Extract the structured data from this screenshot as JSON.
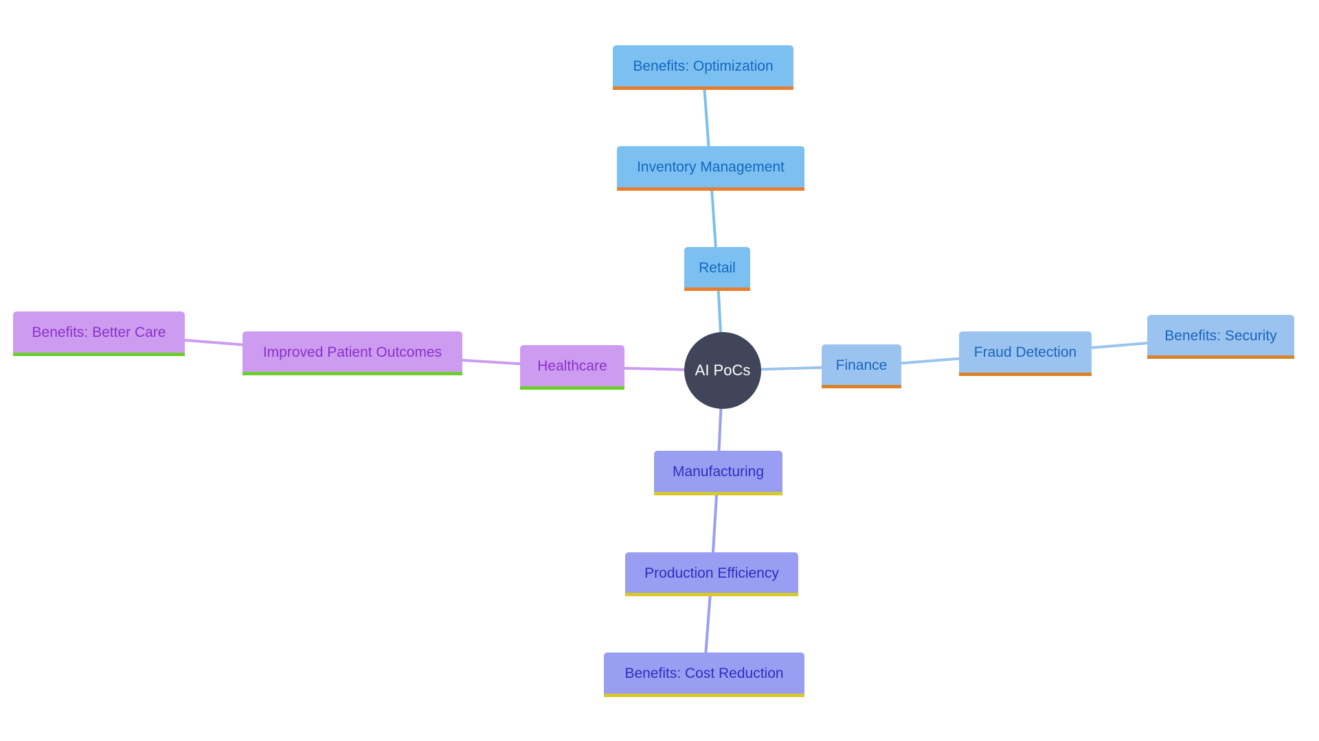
{
  "diagram": {
    "type": "mindmap",
    "root": {
      "id": "root",
      "label": "AI PoCs"
    },
    "colors": {
      "root_fill": "#414559",
      "root_text": "#ffffff",
      "retail": {
        "fill": "#7cc0f1",
        "text": "#1467c0",
        "accent": "#e87d2f",
        "edge": "#7dc0ee"
      },
      "finance": {
        "fill": "#9ac4ef",
        "text": "#1b64bf",
        "accent": "#d8822a",
        "edge": "#9ac4ee"
      },
      "healthcare": {
        "fill": "#cd9cf1",
        "text": "#8b30c9",
        "accent": "#6cce2e",
        "edge": "#cc9cf0"
      },
      "manufacturing": {
        "fill": "#9a9ef2",
        "text": "#2b2fc0",
        "accent": "#d7c92a",
        "edge": "#9a9ef0"
      }
    },
    "nodes": [
      {
        "id": "retail",
        "label": "Retail",
        "branch": "retail",
        "parent": "root"
      },
      {
        "id": "inventory",
        "label": "Inventory Management",
        "branch": "retail",
        "parent": "retail"
      },
      {
        "id": "optimization",
        "label": "Benefits: Optimization",
        "branch": "retail",
        "parent": "inventory"
      },
      {
        "id": "finance",
        "label": "Finance",
        "branch": "finance",
        "parent": "root"
      },
      {
        "id": "fraud",
        "label": "Fraud Detection",
        "branch": "finance",
        "parent": "finance"
      },
      {
        "id": "security",
        "label": "Benefits: Security",
        "branch": "finance",
        "parent": "fraud"
      },
      {
        "id": "healthcare",
        "label": "Healthcare",
        "branch": "healthcare",
        "parent": "root"
      },
      {
        "id": "patient",
        "label": "Improved Patient Outcomes",
        "branch": "healthcare",
        "parent": "healthcare"
      },
      {
        "id": "care",
        "label": "Benefits: Better Care",
        "branch": "healthcare",
        "parent": "patient"
      },
      {
        "id": "manufacturing",
        "label": "Manufacturing",
        "branch": "manufacturing",
        "parent": "root"
      },
      {
        "id": "production",
        "label": "Production Efficiency",
        "branch": "manufacturing",
        "parent": "manufacturing"
      },
      {
        "id": "cost",
        "label": "Benefits: Cost Reduction",
        "branch": "manufacturing",
        "parent": "production"
      }
    ]
  }
}
